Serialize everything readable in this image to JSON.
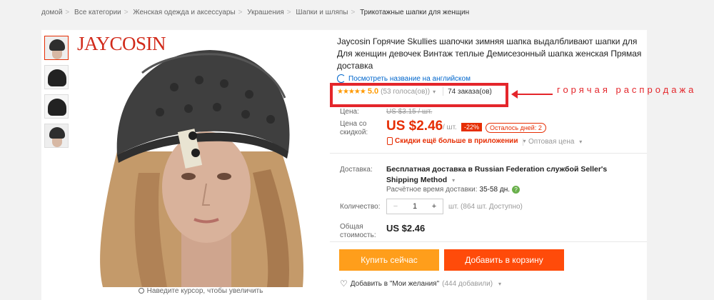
{
  "breadcrumb": [
    "домой",
    "Все категории",
    "Женская одежда и аксессуары",
    "Украшения",
    "Шапки и шляпы",
    "Трикотажные шапки для женщин"
  ],
  "gallery": {
    "brand": "JAYCOSIN",
    "zoom_hint": "Наведите курсор, чтобы увеличить"
  },
  "product": {
    "title": "Jaycosin Горячие Skullies шапочки зимняя шапка выдалбливают шапки для Для женщин девочек Винтаж теплые Демисезонный шапка женская Прямая доставка",
    "translate_link": "Посмотреть название на английском",
    "stars": "★★★★★",
    "rating": "5.0",
    "votes": "(53 голоса(ов))",
    "orders": "74 заказа(ов)",
    "annotation": "горячая распродажа"
  },
  "price": {
    "label": "Цена:",
    "old": "US $3.15 / шт.",
    "discount_label": "Цена со скидкой:",
    "current": "US $2.46",
    "unit": "/ шт.",
    "discount": "-22%",
    "days_left": "Осталось дней: 2",
    "app_promo": "Скидки ещё больше в приложении",
    "wholesale": "Оптовая цена"
  },
  "shipping": {
    "label": "Доставка:",
    "method": "Бесплатная доставка в Russian Federation службой Seller's Shipping Method",
    "time_label": "Расчётное время доставки:",
    "time_value": "35-58 дн."
  },
  "quantity": {
    "label": "Количество:",
    "value": "1",
    "minus": "−",
    "plus": "+",
    "available": "шт. (864 шт. Доступно)"
  },
  "total": {
    "label": "Общая стоимость:",
    "value": "US $2.46"
  },
  "actions": {
    "buy": "Купить сейчас",
    "cart": "Добавить в корзину",
    "wishlist": "Добавить в \"Мои желания\"",
    "wishlist_count": "(444 добавили)"
  }
}
